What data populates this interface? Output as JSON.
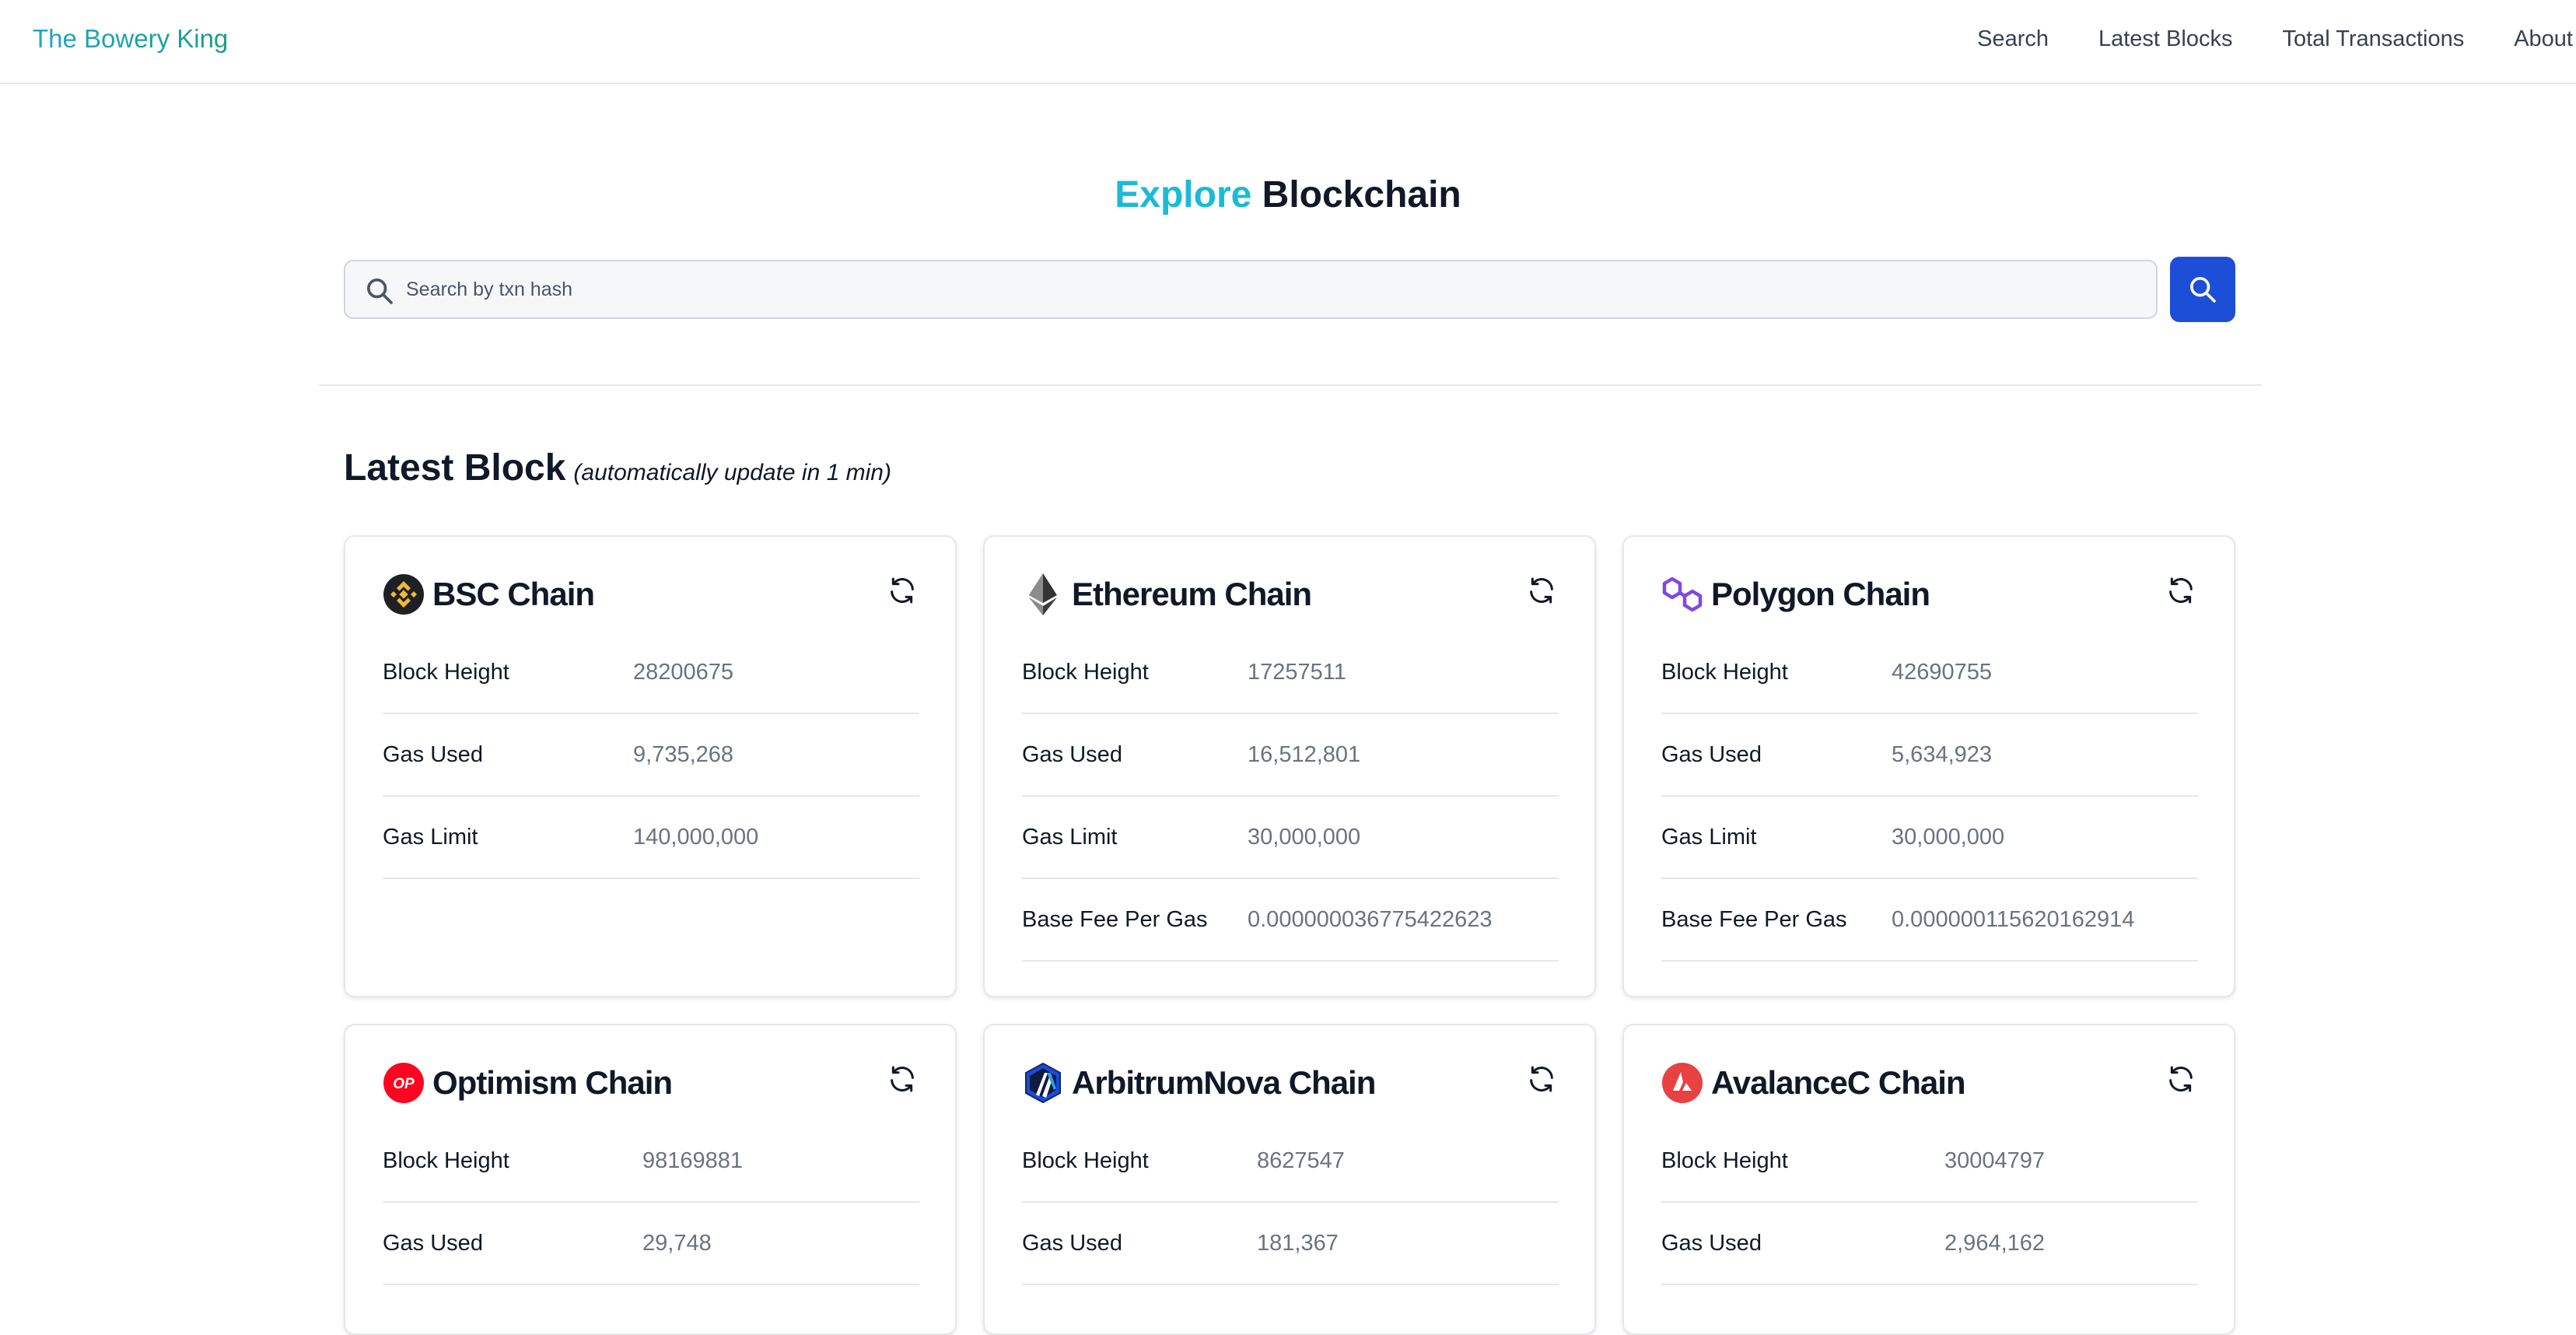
{
  "nav": {
    "brand": "The Bowery King",
    "links": [
      "Search",
      "Latest Blocks",
      "Total Transactions",
      "About"
    ]
  },
  "hero": {
    "title_accent": "Explore",
    "title_rest": "Blockchain",
    "search_placeholder": "Search by txn hash",
    "search_value": ""
  },
  "section": {
    "title": "Latest Block",
    "subtitle": "(automatically update in 1 min)"
  },
  "labels": {
    "block_height": "Block Height",
    "gas_used": "Gas Used",
    "gas_limit": "Gas Limit",
    "base_fee": "Base Fee Per Gas"
  },
  "cards": [
    {
      "name": "BSC Chain",
      "icon": "bsc-logo-icon",
      "block_height": "28200675",
      "gas_used": "9,735,268",
      "gas_limit": "140,000,000",
      "base_fee": null
    },
    {
      "name": "Ethereum Chain",
      "icon": "ethereum-logo-icon",
      "block_height": "17257511",
      "gas_used": "16,512,801",
      "gas_limit": "30,000,000",
      "base_fee": "0.000000036775422623"
    },
    {
      "name": "Polygon Chain",
      "icon": "polygon-logo-icon",
      "block_height": "42690755",
      "gas_used": "5,634,923",
      "gas_limit": "30,000,000",
      "base_fee": "0.000000115620162914"
    },
    {
      "name": "Optimism Chain",
      "icon": "optimism-logo-icon",
      "logo_text": "OP",
      "block_height": "98169881",
      "gas_used": "29,748"
    },
    {
      "name": "ArbitrumNova Chain",
      "icon": "arbitrum-nova-logo-icon",
      "block_height": "8627547",
      "gas_used": "181,367"
    },
    {
      "name": "AvalanceC Chain",
      "icon": "avalanche-logo-icon",
      "block_height": "30004797",
      "gas_used": "2,964,162"
    }
  ],
  "colors": {
    "accent": "#1bbad6",
    "search_button": "#1d4ed8",
    "brand_gradient_start": "#22a5c6",
    "brand_gradient_end": "#179e8a"
  }
}
